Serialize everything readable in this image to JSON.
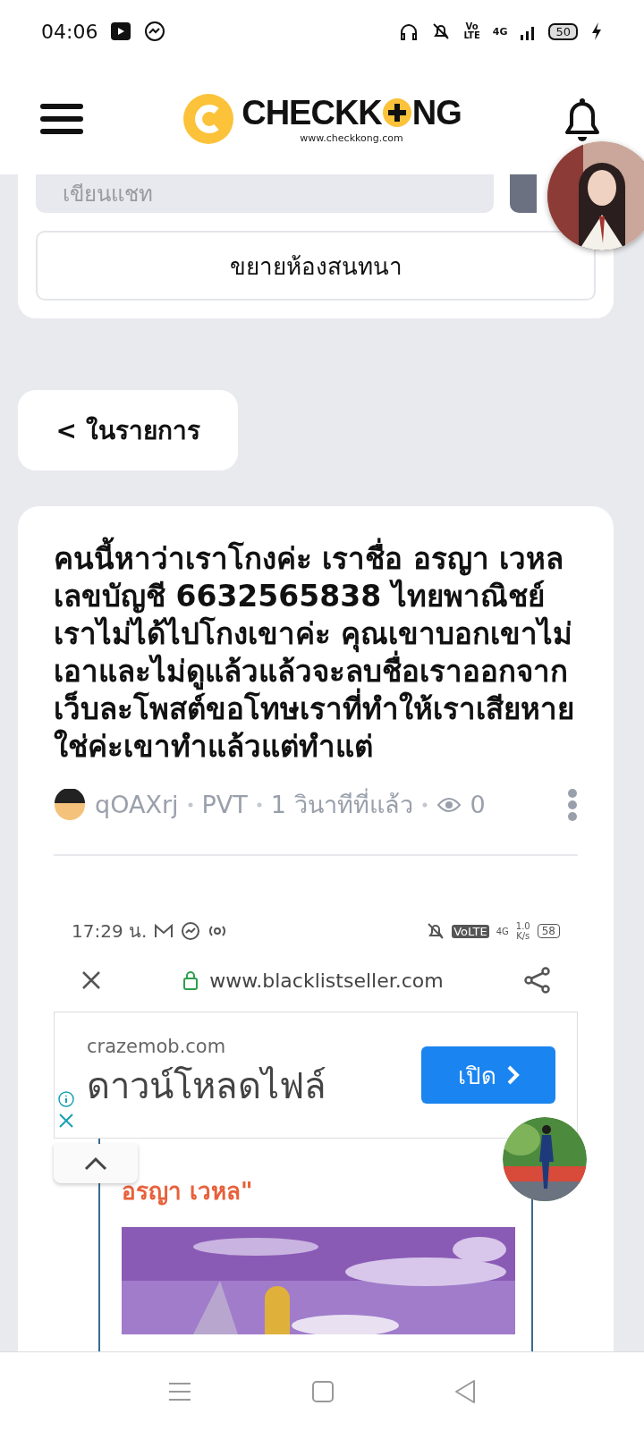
{
  "status_bar": {
    "time": "04:06",
    "volte_top": "Vo",
    "volte_bottom": "LTE",
    "network": "4G",
    "battery": "50"
  },
  "header": {
    "logo_start": "CHECKK",
    "logo_end": "NG",
    "logo_url": "www.checkkong.com"
  },
  "chat": {
    "placeholder": "เขียนแชท",
    "expand_button": "ขยายห้องสนทนา"
  },
  "back_button": "< ในรายการ",
  "post": {
    "title": "คนนี้หาว่าเราโกงค่ะ เราชื่อ อรญา เวหล เลขบัญชี 6632565838 ไทยพาณิชย์ เราไม่ได้ไปโกงเขาค่ะ คุณเขาบอกเขาไม่เอาและไม่ดูแล้วแล้วจะลบชื่อเราออกจากเว็บละโพสต์ขอโทษเราที่ทำให้เราเสียหายใช่ค่ะเขาทำแล้วแต่ทำแต่",
    "author": "qOAXrj",
    "tag": "PVT",
    "time": "1 วินาทีที่แล้ว",
    "views": "0",
    "screenshot": {
      "time": "17:29 น.",
      "volte": "VoLTE",
      "network": "4G",
      "speed_value": "1.0",
      "speed_unit": "K/s",
      "battery": "58",
      "url": "www.blacklistseller.com",
      "ad": {
        "domain": "crazemob.com",
        "headline": "ดาวน์โหลดไฟล์",
        "button": "เปิด"
      },
      "article_title": "อรญา เวหล\""
    }
  }
}
